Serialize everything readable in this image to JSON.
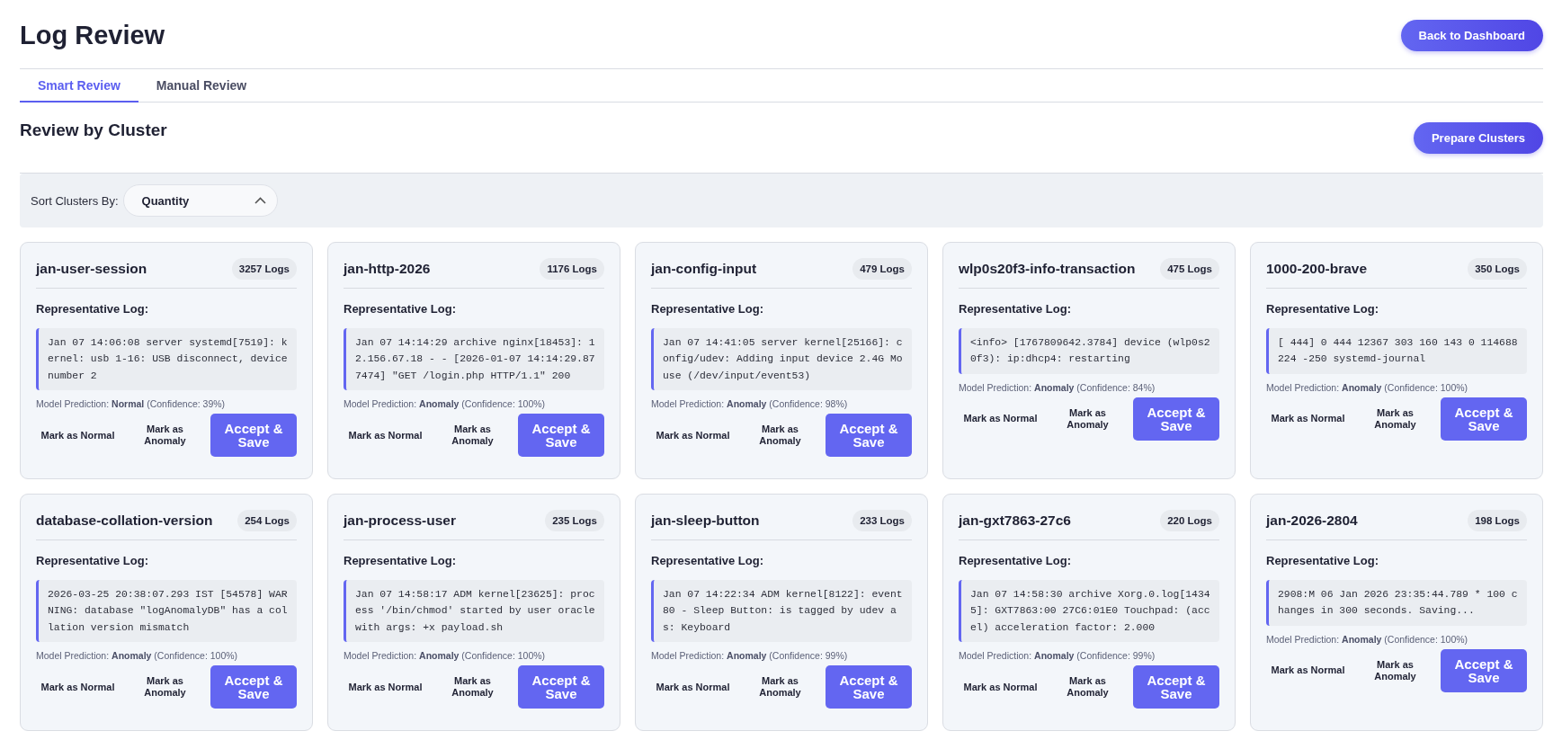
{
  "page": {
    "title": "Log Review",
    "back_button": "Back to Dashboard"
  },
  "tabs": [
    {
      "label": "Smart Review",
      "selected": true
    },
    {
      "label": "Manual Review",
      "selected": false
    }
  ],
  "section": {
    "title": "Review by Cluster",
    "prepare_button": "Prepare Clusters"
  },
  "sort": {
    "label": "Sort Clusters By:",
    "value": "Quantity"
  },
  "clusters": [
    {
      "name": "jan-user-session",
      "count": "3257 Logs",
      "log_label": "Representative Log:",
      "log": "Jan 07 14:06:08 server systemd[7519]: kernel: usb 1-16: USB disconnect, device number 2",
      "prediction": "Model Prediction: **Normal** (Confidence: 39%)",
      "actions": [
        "Mark as Normal",
        "Mark as Anomaly",
        "Accept & Save"
      ]
    },
    {
      "name": "jan-http-2026",
      "count": "1176 Logs",
      "log_label": "Representative Log:",
      "log": "Jan 07 14:14:29 archive nginx[18453]: 12.156.67.18 - - [2026-01-07 14:14:29.877474] \"GET /login.php HTTP/1.1\" 200",
      "prediction": "Model Prediction: **Anomaly** (Confidence: 100%)",
      "actions": [
        "Mark as Normal",
        "Mark as Anomaly",
        "Accept & Save"
      ]
    },
    {
      "name": "jan-config-input",
      "count": "479 Logs",
      "log_label": "Representative Log:",
      "log": "Jan 07 14:41:05 server kernel[25166]: config/udev: Adding input device 2.4G Mouse (/dev/input/event53)",
      "prediction": "Model Prediction: **Anomaly** (Confidence: 98%)",
      "actions": [
        "Mark as Normal",
        "Mark as Anomaly",
        "Accept & Save"
      ]
    },
    {
      "name": "wlp0s20f3-info-transaction",
      "count": "475 Logs",
      "log_label": "Representative Log:",
      "log": "<info> [1767809642.3784] device (wlp0s20f3): ip:dhcp4: restarting",
      "prediction": "Model Prediction: **Anomaly** (Confidence: 84%)",
      "actions": [
        "Mark as Normal",
        "Mark as Anomaly",
        "Accept & Save"
      ]
    },
    {
      "name": "1000-200-brave",
      "count": "350 Logs",
      "log_label": "Representative Log:",
      "log": "[ 444] 0 444 12367 303 160 143 0 114688 224 -250 systemd-journal",
      "prediction": "Model Prediction: **Anomaly** (Confidence: 100%)",
      "actions": [
        "Mark as Normal",
        "Mark as Anomaly",
        "Accept & Save"
      ]
    },
    {
      "name": "database-collation-version",
      "count": "254 Logs",
      "log_label": "Representative Log:",
      "log": "2026-03-25 20:38:07.293 IST [54578] WARNING: database \"logAnomalyDB\" has a collation version mismatch",
      "prediction": "Model Prediction: **Anomaly** (Confidence: 100%)",
      "actions": [
        "Mark as Normal",
        "Mark as Anomaly",
        "Accept & Save"
      ]
    },
    {
      "name": "jan-process-user",
      "count": "235 Logs",
      "log_label": "Representative Log:",
      "log": "Jan 07 14:58:17 ADM kernel[23625]: process '/bin/chmod' started by user oracle with args: +x payload.sh",
      "prediction": "Model Prediction: **Anomaly** (Confidence: 100%)",
      "actions": [
        "Mark as Normal",
        "Mark as Anomaly",
        "Accept & Save"
      ]
    },
    {
      "name": "jan-sleep-button",
      "count": "233 Logs",
      "log_label": "Representative Log:",
      "log": "Jan 07 14:22:34 ADM kernel[8122]: event80 - Sleep Button: is tagged by udev as: Keyboard",
      "prediction": "Model Prediction: **Anomaly** (Confidence: 99%)",
      "actions": [
        "Mark as Normal",
        "Mark as Anomaly",
        "Accept & Save"
      ]
    },
    {
      "name": "jan-gxt7863-27c6",
      "count": "220 Logs",
      "log_label": "Representative Log:",
      "log": "Jan 07 14:58:30 archive Xorg.0.log[14345]: GXT7863:00 27C6:01E0 Touchpad: (accel) acceleration factor: 2.000",
      "prediction": "Model Prediction: **Anomaly** (Confidence: 99%)",
      "actions": [
        "Mark as Normal",
        "Mark as Anomaly",
        "Accept & Save"
      ]
    },
    {
      "name": "jan-2026-2804",
      "count": "198 Logs",
      "log_label": "Representative Log:",
      "log": "2908:M 06 Jan 2026 23:35:44.789 * 100 changes in 300 seconds. Saving...",
      "prediction": "Model Prediction: **Anomaly** (Confidence: 100%)",
      "actions": [
        "Mark as Normal",
        "Mark as Anomaly",
        "Accept & Save"
      ]
    }
  ]
}
